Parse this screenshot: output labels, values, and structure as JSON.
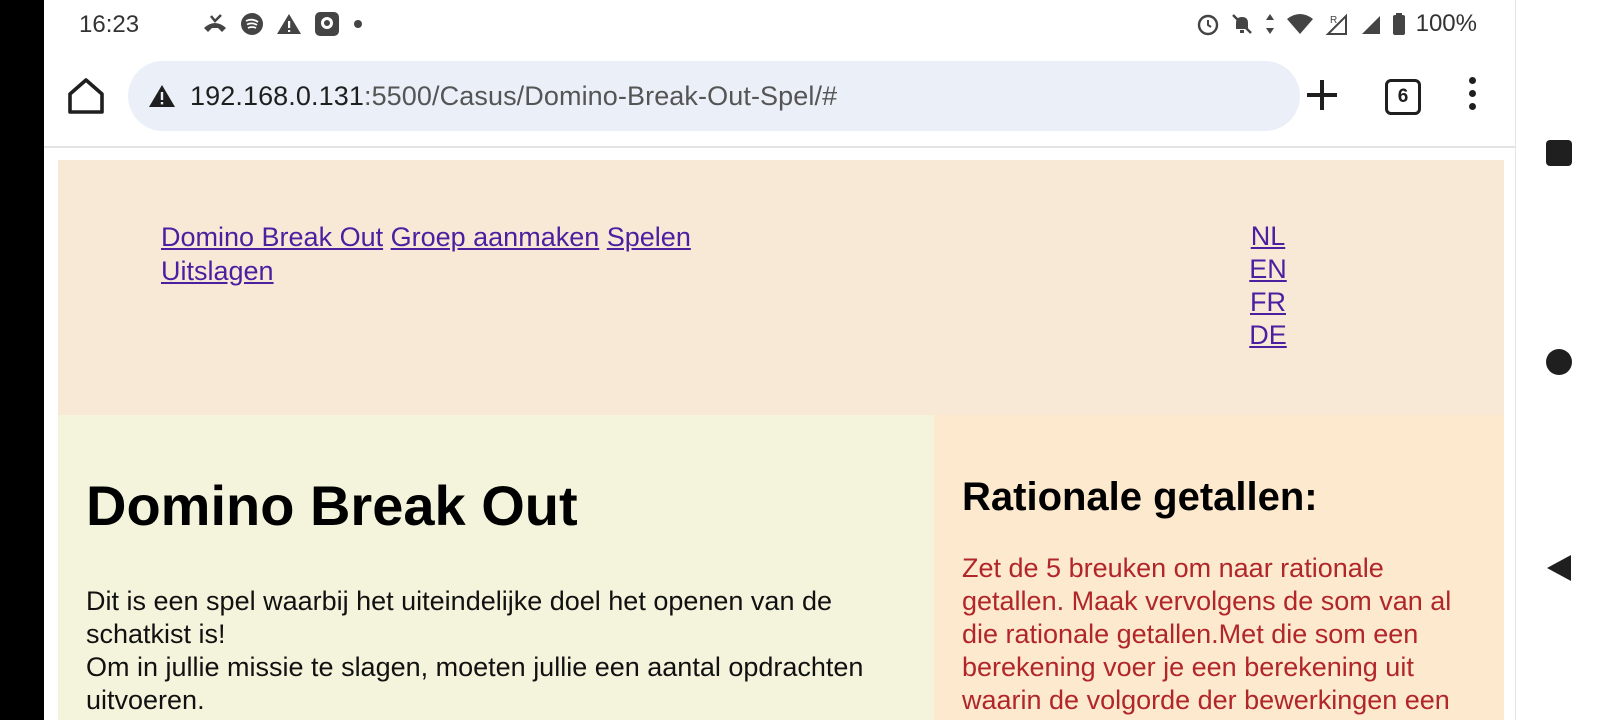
{
  "status_bar": {
    "time": "16:23",
    "battery": "100%",
    "left_icons": [
      "missed-call-icon",
      "spotify-icon",
      "warning-icon",
      "app-notification-icon",
      "more-dot-icon"
    ],
    "right_icons": [
      "alarm-icon",
      "silent-bell-icon",
      "data-arrows-icon",
      "wifi-icon",
      "signal-roaming-icon",
      "signal-icon",
      "battery-icon"
    ]
  },
  "browser": {
    "url_host": "192.168.0.131",
    "url_rest": ":5500/Casus/Domino-Break-Out-Spel/#",
    "tab_count": "6"
  },
  "site_nav": {
    "links": [
      "Domino Break Out",
      "Groep aanmaken",
      "Spelen",
      "Uitslagen"
    ],
    "languages": [
      "NL",
      "EN",
      "FR",
      "DE"
    ]
  },
  "main": {
    "title": "Domino Break Out",
    "intro_line1": "Dit is een spel waarbij het uiteindelijke doel het openen van de schatkist is!",
    "intro_line2": "Om in jullie missie te slagen, moeten jullie een aantal opdrachten uitvoeren."
  },
  "aside": {
    "title": "Rationale getallen:",
    "text": "Zet de 5 breuken om naar rationale getallen. Maak vervolgens de som van al die rationale getallen.Met die som een berekening voer je een berekening uit waarin de volgorde der bewerkingen een"
  },
  "colors": {
    "header_bg": "#f8e9d7",
    "main_bg": "#f4f4dc",
    "aside_bg": "#fde9cd",
    "link": "#4b1fa0",
    "aside_text": "#b0262a"
  }
}
